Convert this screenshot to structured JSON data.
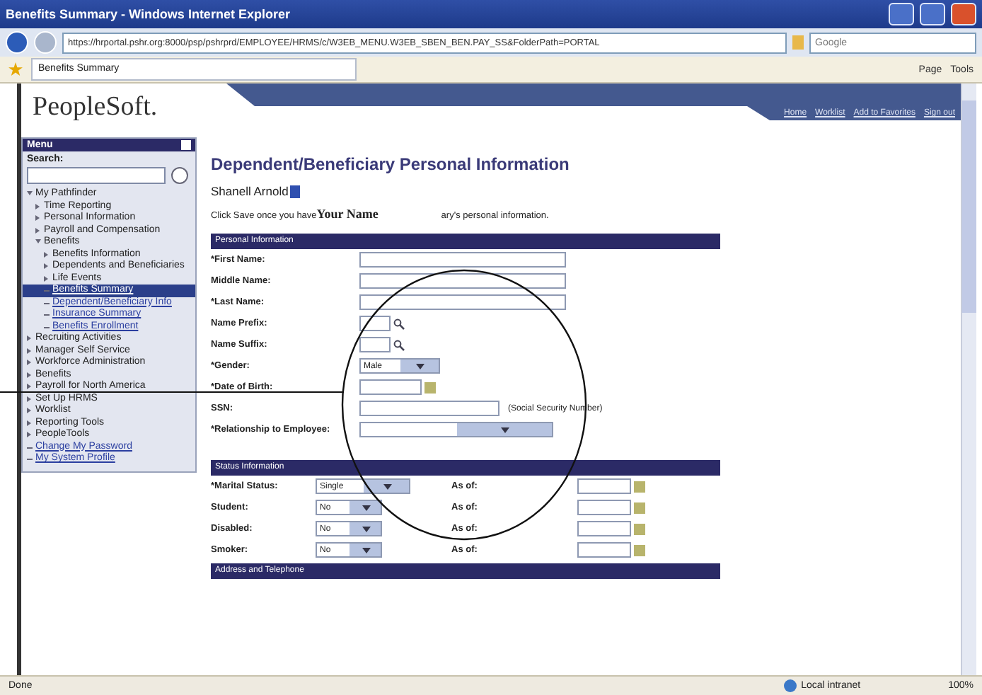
{
  "window": {
    "title": "Benefits Summary - Windows Internet Explorer"
  },
  "address_bar": {
    "url": "https://hrportal.pshr.org:8000/psp/pshrprd/EMPLOYEE/HRMS/c/W3EB_MENU.W3EB_SBEN_BEN.PAY_SS&FolderPath=PORTAL",
    "search_placeholder": "Google"
  },
  "favorites_bar": {
    "tab": "Benefits Summary",
    "commands": [
      "Page",
      "Tools"
    ]
  },
  "header": {
    "logo": "PeopleSoft.",
    "links": [
      "Home",
      "Worklist",
      "Add to Favorites",
      "Sign out"
    ]
  },
  "menu": {
    "title": "Menu",
    "search_label": "Search:",
    "items": [
      {
        "label": "My Pathfinder",
        "kind": "folder",
        "expanded": true,
        "selected": false,
        "children": [
          {
            "label": "Time Reporting",
            "kind": "folder",
            "selected": false
          },
          {
            "label": "Personal Information",
            "kind": "folder",
            "selected": false
          },
          {
            "label": "Payroll and Compensation",
            "kind": "folder",
            "selected": false
          },
          {
            "label": "Benefits",
            "kind": "folder",
            "expanded": true,
            "selected": false,
            "children": [
              {
                "label": "Benefits Information",
                "kind": "folder",
                "selected": false
              },
              {
                "label": "Dependents and Beneficiaries",
                "kind": "folder",
                "selected": false
              },
              {
                "label": "Life Events",
                "kind": "folder",
                "selected": false
              },
              {
                "label": "Benefits Summary",
                "kind": "link",
                "selected": true
              },
              {
                "label": "Dependent/Beneficiary Info",
                "kind": "link",
                "selected": false
              },
              {
                "label": "Insurance Summary",
                "kind": "link",
                "selected": false
              },
              {
                "label": "Benefits Enrollment",
                "kind": "link",
                "selected": false
              }
            ]
          }
        ]
      },
      {
        "label": "Recruiting Activities",
        "kind": "folder",
        "selected": false
      },
      {
        "label": "Manager Self Service",
        "kind": "folder",
        "selected": false
      },
      {
        "label": "Workforce Administration",
        "kind": "folder",
        "selected": false
      },
      {
        "label": "Benefits",
        "kind": "folder",
        "selected": false
      },
      {
        "label": "Payroll for North America",
        "kind": "folder",
        "selected": false
      },
      {
        "label": "Set Up HRMS",
        "kind": "folder",
        "selected": false
      },
      {
        "label": "Worklist",
        "kind": "folder",
        "selected": false
      },
      {
        "label": "Reporting Tools",
        "kind": "folder",
        "selected": false
      },
      {
        "label": "PeopleTools",
        "kind": "folder",
        "selected": false
      },
      {
        "label": "Change My Password",
        "kind": "link",
        "selected": false
      },
      {
        "label": "My System Profile",
        "kind": "link",
        "selected": false
      }
    ]
  },
  "page": {
    "title": "Dependent/Beneficiary Personal Information",
    "employee": "Shanell Arnold",
    "instruction_start": "Click Save once you have",
    "overlay_label": "Your Name",
    "instruction_end": "ary's personal information.",
    "personal": {
      "title": "Personal Information",
      "fields": [
        {
          "label": "*First Name:",
          "kind": "text"
        },
        {
          "label": "Middle Name:",
          "kind": "text"
        },
        {
          "label": "*Last Name:",
          "kind": "text"
        },
        {
          "label": "Name Prefix:",
          "kind": "lookup"
        },
        {
          "label": "Name Suffix:",
          "kind": "lookup"
        },
        {
          "label": "*Gender:",
          "kind": "select",
          "value": "Male"
        },
        {
          "label": "*Date of Birth:",
          "kind": "date"
        },
        {
          "label": "SSN:",
          "kind": "ssn",
          "note": "(Social Security Number)"
        },
        {
          "label": "*Relationship to Employee:",
          "kind": "select"
        }
      ]
    },
    "status": {
      "title": "Status Information",
      "rows": [
        {
          "label": "*Marital Status:",
          "value": "Single",
          "as_of": "As of:"
        },
        {
          "label": "Student:",
          "value": "No",
          "as_of": "As of:"
        },
        {
          "label": "Disabled:",
          "value": "No",
          "as_of": "As of:"
        },
        {
          "label": "Smoker:",
          "value": "No",
          "as_of": "As of:"
        }
      ]
    },
    "next_section": "Address and Telephone"
  },
  "status_bar": {
    "text": "Done",
    "zone": "Local intranet",
    "zoom": "100%"
  }
}
